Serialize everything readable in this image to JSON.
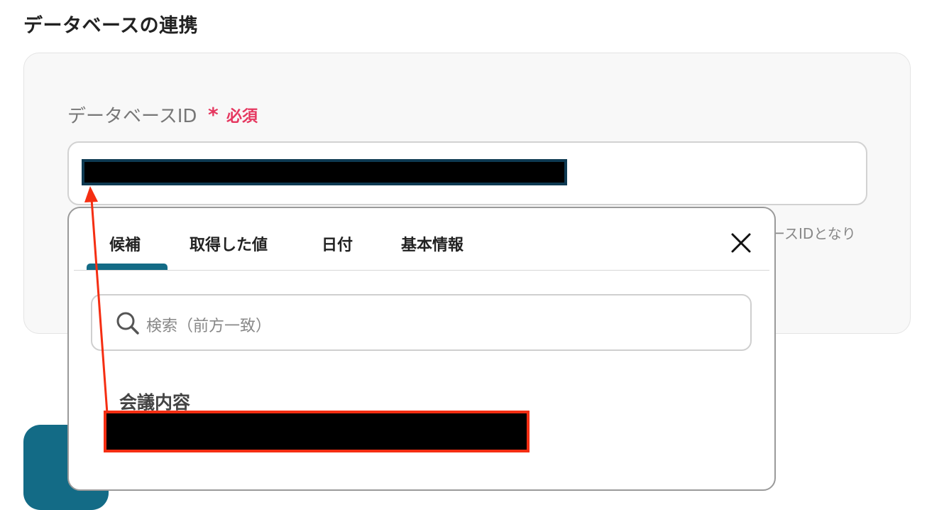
{
  "section": {
    "title": "データベースの連携"
  },
  "field": {
    "label": "データベースID",
    "required_star": "*",
    "required_text": "必須",
    "hint_partial": "ースIDとなり",
    "value_redacted": true
  },
  "dropdown": {
    "tabs": [
      {
        "label": "候補"
      },
      {
        "label": "取得した値"
      },
      {
        "label": "日付"
      },
      {
        "label": "基本情報"
      }
    ],
    "active_tab": "候補",
    "close_icon": "close-icon",
    "search": {
      "placeholder": "検索（前方一致）",
      "icon": "search-icon"
    },
    "group": {
      "label": "会議内容"
    },
    "candidate_redacted": true
  },
  "colors": {
    "accent": "#136b86",
    "required": "#e5375f",
    "annotation": "#f52e12",
    "panel_bg": "#f8f8f8"
  }
}
